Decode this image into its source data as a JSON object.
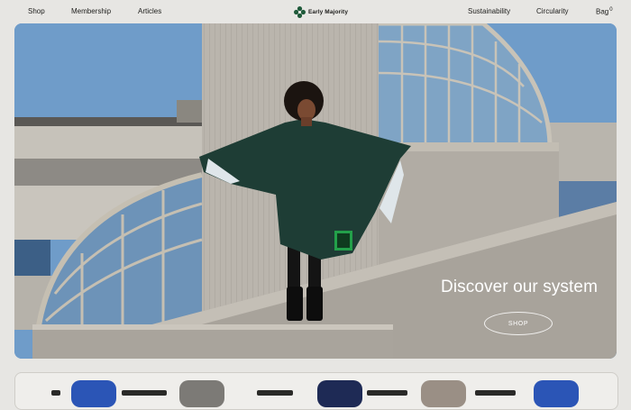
{
  "nav": {
    "left": [
      {
        "label": "Shop"
      },
      {
        "label": "Membership"
      },
      {
        "label": "Articles"
      }
    ],
    "brand": "Early Majority",
    "right": [
      {
        "label": "Sustainability"
      },
      {
        "label": "Circularity"
      },
      {
        "label": "Bag",
        "count": "0"
      }
    ]
  },
  "hero": {
    "headline": "Discover our system",
    "cta_label": "SHOP"
  },
  "colors": {
    "background": "#e7e6e3",
    "brand_green": "#1f5a3a",
    "sky": "#6f9cc9",
    "poncho": "#1e3d35"
  },
  "icons": {
    "logo": "flower-logo-icon"
  }
}
